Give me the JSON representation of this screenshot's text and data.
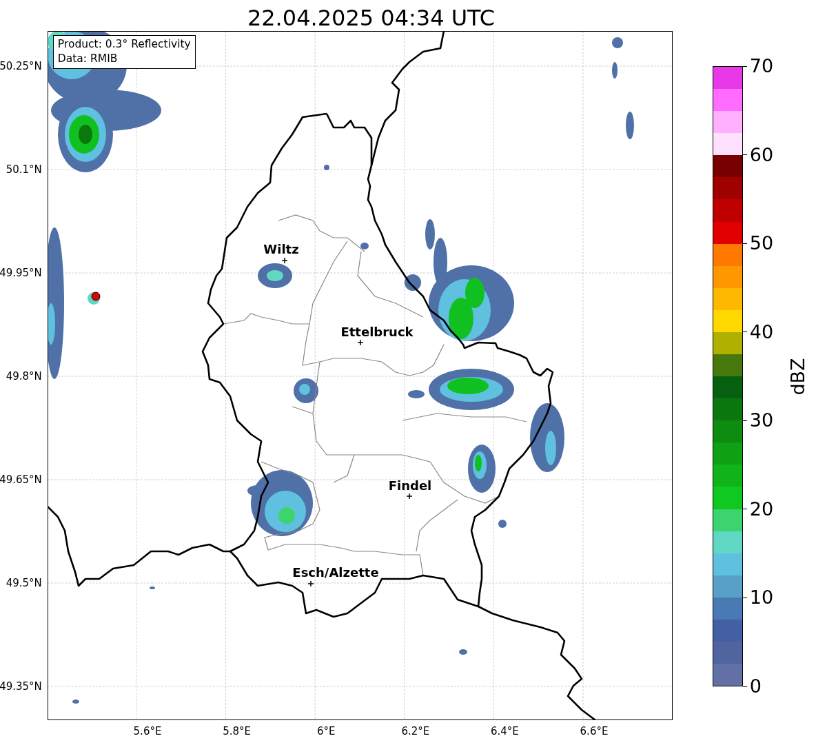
{
  "title": "22.04.2025 04:34 UTC",
  "info_box": {
    "lines": [
      "Product: 0.3° Reflectivity",
      "Data: RMIB"
    ]
  },
  "map": {
    "y_ticks": [
      "50.25°N",
      "50.1°N",
      "49.95°N",
      "49.8°N",
      "49.65°N",
      "49.5°N",
      "49.35°N"
    ],
    "x_ticks": [
      "5.6°E",
      "5.8°E",
      "6°E",
      "6.2°E",
      "6.4°E",
      "6.6°E"
    ],
    "cities": [
      {
        "name": "Wiltz"
      },
      {
        "name": "Ettelbruck"
      },
      {
        "name": "Findel"
      },
      {
        "name": "Esch/Alzette"
      }
    ]
  },
  "colorbar": {
    "label": "dBZ",
    "ticks": [
      "70",
      "60",
      "50",
      "40",
      "30",
      "20",
      "10",
      "0"
    ],
    "bins": [
      {
        "color": "#e838e8"
      },
      {
        "color": "#ff6cff"
      },
      {
        "color": "#ffb0ff"
      },
      {
        "color": "#ffe0ff"
      },
      {
        "color": "#780000"
      },
      {
        "color": "#a00000"
      },
      {
        "color": "#c00000"
      },
      {
        "color": "#e00000"
      },
      {
        "color": "#ff7800"
      },
      {
        "color": "#ff9800"
      },
      {
        "color": "#ffb800"
      },
      {
        "color": "#ffd800"
      },
      {
        "color": "#b0b000"
      },
      {
        "color": "#46780c"
      },
      {
        "color": "#066010"
      },
      {
        "color": "#0a780c"
      },
      {
        "color": "#0e8c10"
      },
      {
        "color": "#10a014"
      },
      {
        "color": "#10b418"
      },
      {
        "color": "#10c820"
      },
      {
        "color": "#3cd46c"
      },
      {
        "color": "#60d8c4"
      },
      {
        "color": "#60c0e0"
      },
      {
        "color": "#58a0c8"
      },
      {
        "color": "#4a7ab4"
      },
      {
        "color": "#4460a4"
      },
      {
        "color": "#5064a0"
      },
      {
        "color": "#6370a6"
      }
    ]
  }
}
